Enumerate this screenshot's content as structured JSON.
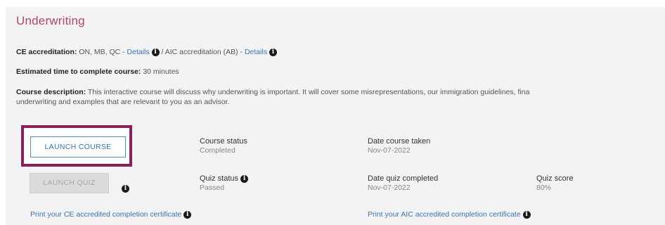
{
  "course": {
    "title": "Underwriting",
    "ce_label": "CE accreditation:",
    "ce_value": "ON, MB, QC -",
    "ce_details": "Details",
    "aic_label": "/ AIC accreditation (AB) -",
    "aic_details": "Details",
    "time_label": "Estimated time to complete course:",
    "time_value": "30 minutes",
    "desc_label": "Course description:",
    "desc_line1": "This interactive course will discuss why underwriting is important. It will cover some misrepresentations, our immigration guidelines, fina",
    "desc_line2": "underwriting and examples that are relevant to you as an advisor."
  },
  "actions": {
    "launch_course": "LAUNCH COURSE",
    "launch_quiz": "LAUNCH QUIZ"
  },
  "status": {
    "course_status_label": "Course status",
    "course_status_value": "Completed",
    "date_taken_label": "Date course taken",
    "date_taken_value": "Nov-07-2022",
    "quiz_status_label": "Quiz status",
    "quiz_status_value": "Passed",
    "quiz_date_label": "Date quiz completed",
    "quiz_date_value": "Nov-07-2022",
    "quiz_score_label": "Quiz score",
    "quiz_score_value": "80%"
  },
  "certificates": {
    "ce": "Print your CE accredited completion certificate",
    "aic": "Print your AIC accredited completion certificate"
  },
  "info_glyph": "❶",
  "colors": {
    "title": "#b3446c",
    "link": "#3a73b5",
    "highlight_border": "#8a1f5c",
    "panel_bg": "#f3f3f3"
  }
}
